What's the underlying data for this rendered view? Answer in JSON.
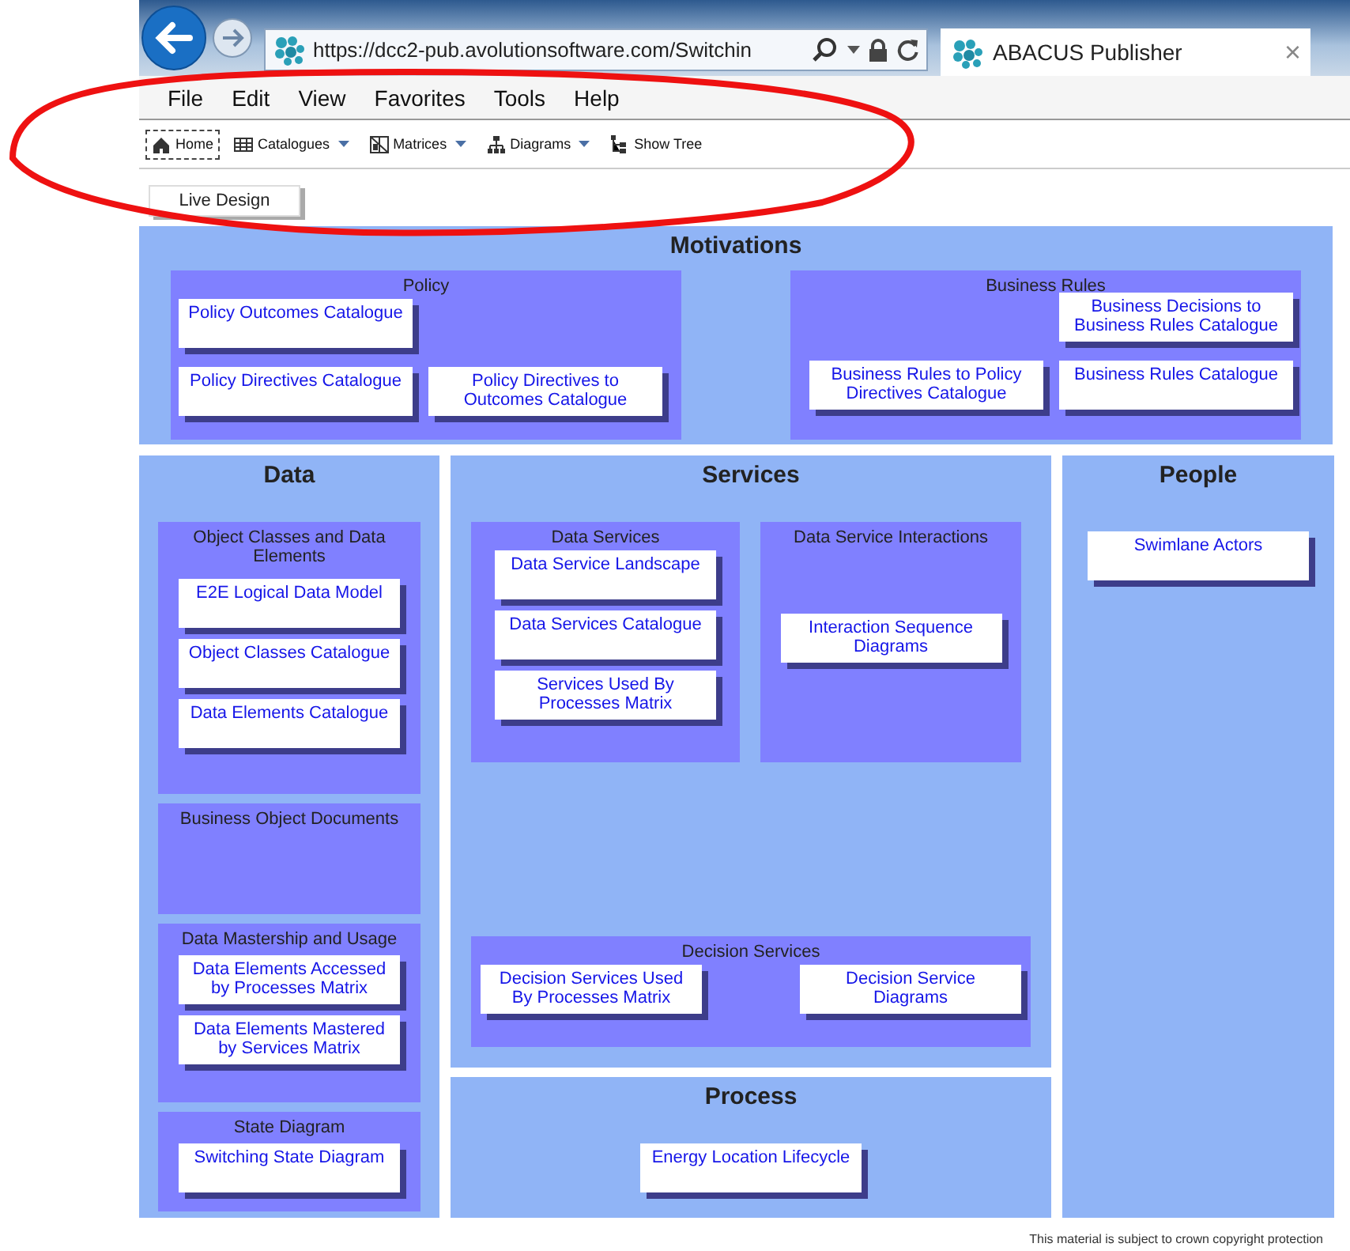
{
  "browser": {
    "url": "https://dcc2-pub.avolutionsoftware.com/Switchin",
    "tab_title": "ABACUS Publisher",
    "tab_close": "×"
  },
  "menu": [
    "File",
    "Edit",
    "View",
    "Favorites",
    "Tools",
    "Help"
  ],
  "toolbar": [
    {
      "label": "Home",
      "dropdown": false,
      "focused": true
    },
    {
      "label": "Catalogues",
      "dropdown": true,
      "focused": false
    },
    {
      "label": "Matrices",
      "dropdown": true,
      "focused": false
    },
    {
      "label": "Diagrams",
      "dropdown": true,
      "focused": false
    },
    {
      "label": "Show Tree",
      "dropdown": false,
      "focused": false
    }
  ],
  "live_design": "Live Design",
  "motivations": {
    "title": "Motivations",
    "groups": [
      {
        "title": "Policy",
        "rows": [
          [
            "Policy Outcomes Catalogue"
          ],
          [
            "Policy Directives Catalogue",
            "Policy Directives to Outcomes Catalogue"
          ]
        ]
      },
      {
        "title": "Business Rules",
        "rows": [
          [
            "",
            "Business Decisions to Business Rules Catalogue"
          ],
          [
            "Business Rules to Policy Directives Catalogue",
            "Business Rules Catalogue"
          ]
        ]
      }
    ]
  },
  "data": {
    "title": "Data",
    "groups": [
      {
        "title": "Object Classes and Data Elements",
        "cards": [
          "E2E Logical Data Model",
          "Object Classes Catalogue",
          "Data Elements Catalogue"
        ]
      },
      {
        "title": "Business Object Documents"
      },
      {
        "title": "Data Mastership and Usage",
        "cards": [
          "Data Elements Accessed by Processes Matrix",
          "Data Elements Mastered by Services Matrix"
        ]
      },
      {
        "title": "State Diagram",
        "cards": [
          "Switching State Diagram"
        ]
      }
    ]
  },
  "services": {
    "title": "Services",
    "groups": [
      {
        "title": "Data Services",
        "cards": [
          "Data Service Landscape",
          "Data Services Catalogue",
          "Services Used By Processes Matrix"
        ]
      },
      {
        "title": "Data Service Interactions",
        "cards": [
          "Interaction Sequence Diagrams"
        ]
      },
      {
        "title": "Decision Services",
        "cards": [
          "Decision Services Used By Processes Matrix",
          "Decision Service Diagrams"
        ]
      }
    ]
  },
  "process": {
    "title": "Process",
    "cards": [
      "Energy Location Lifecycle"
    ]
  },
  "people": {
    "title": "People",
    "cards": [
      "Swimlane Actors"
    ]
  },
  "footer": "This material is subject to crown copyright protection"
}
